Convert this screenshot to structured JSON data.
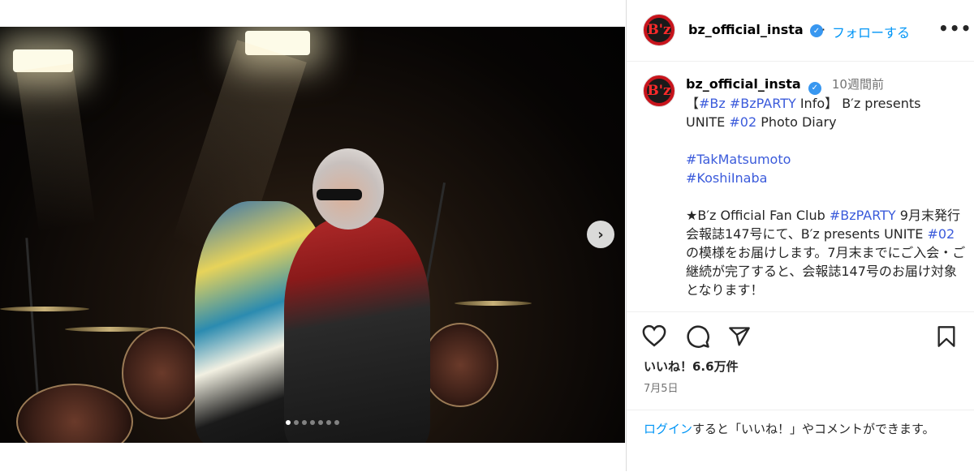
{
  "post": {
    "username": "bz_official_insta",
    "follow_label": "フォローする",
    "more_label": "•••",
    "verified_mark": "✓",
    "avatar_text": "B'z",
    "time_ago": "10週間前",
    "caption": {
      "line1_prefix": "【",
      "tag_bz": "#Bz",
      "tag_bzparty": "#BzPARTY",
      "line1_suffix": " Info】 B′z presents",
      "line2_prefix": "UNITE ",
      "tag_02": "#02",
      "line2_suffix": " Photo Diary",
      "tag_tak": "#TakMatsumoto",
      "tag_koshi": "#KoshiInaba",
      "p3_a": "★B′z Official Fan Club ",
      "p3_tag_bzparty": "#BzPARTY",
      "p3_b": " 9月末発行会報誌147号にて、B′z presents UNITE ",
      "p3_tag_02": "#02",
      "p3_c": " の模様をお届けします。7月末までにご入会・ご継続が完了すると、会報誌147号のお届け対象となります！"
    },
    "likes": "いいね！6.6万件",
    "date": "7月5日",
    "login_link": "ログイン",
    "login_text": "すると「いいね！」やコメントができます。",
    "next_arrow": "›",
    "carousel_count": 7,
    "carousel_active": 0
  },
  "colors": {
    "link_blue": "#0095f6",
    "hashtag": "#3b5bdb",
    "verified": "#3897f0",
    "avatar_red": "#c8141c"
  },
  "icons": [
    "heart-icon",
    "comment-icon",
    "share-icon",
    "bookmark-icon",
    "chevron-right-icon",
    "verified-icon",
    "more-icon"
  ]
}
